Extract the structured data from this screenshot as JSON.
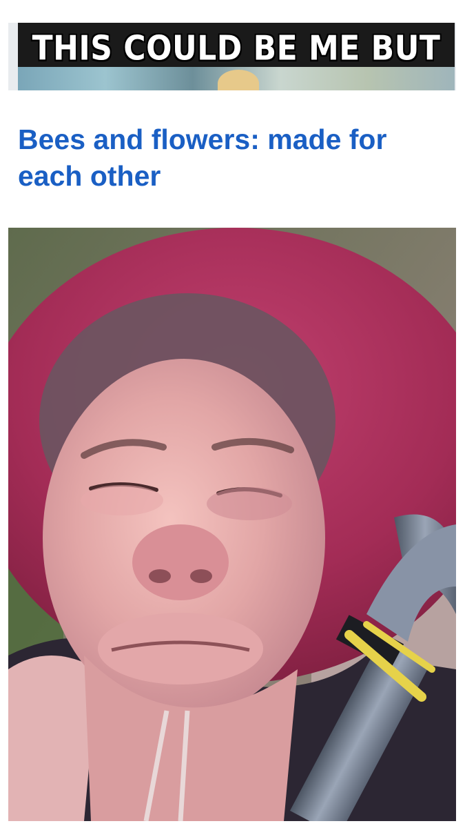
{
  "banner": {
    "caption": "THIS COULD BE ME BUT"
  },
  "article": {
    "headline": "Bees and flowers: made for each other"
  },
  "photo": {
    "description_icon": "selfie-photo"
  }
}
